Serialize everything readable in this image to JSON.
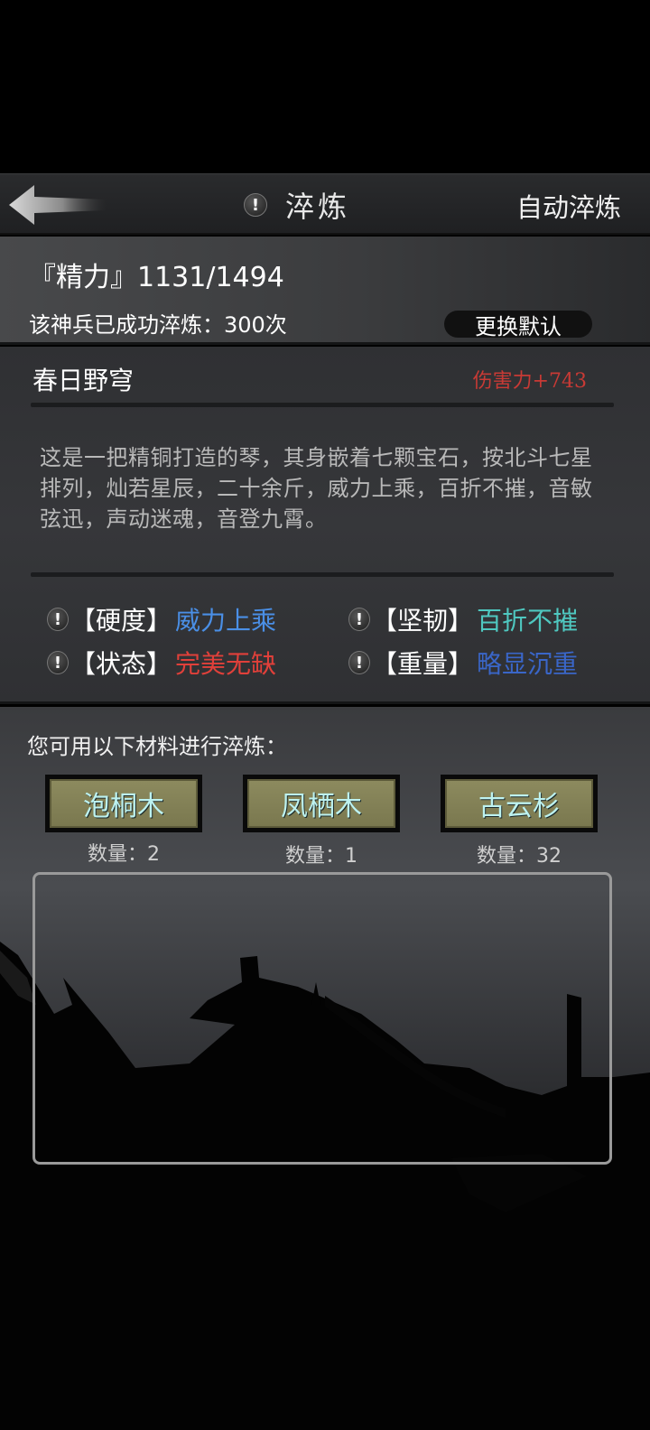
{
  "header": {
    "title": "淬炼",
    "warn_glyph": "!",
    "auto_label": "自动淬炼"
  },
  "stats": {
    "energy": "『精力』1131/1494",
    "refined": "该神兵已成功淬炼：300次",
    "change_default": "更换默认"
  },
  "weapon": {
    "name": "春日野穹",
    "damage": "伤害力+743",
    "description": "这是一把精铜打造的琴，其身嵌着七颗宝石，按北斗七星排列，灿若星辰，二十余斤，威力上乘，百折不摧，音敏弦迅，声动迷魂，音登九霄。",
    "attributes": [
      {
        "label": "【硬度】",
        "value": "威力上乘",
        "color": "#4a8fe6"
      },
      {
        "label": "【坚韧】",
        "value": "百折不摧",
        "color": "#4fc8c0"
      },
      {
        "label": "【状态】",
        "value": "完美无缺",
        "color": "#e0403a"
      },
      {
        "label": "【重量】",
        "value": "略显沉重",
        "color": "#3a66c8"
      }
    ]
  },
  "materials": {
    "prompt": "您可用以下材料进行淬炼：",
    "items": [
      {
        "name": "泡桐木",
        "qty": "数量：2"
      },
      {
        "name": "凤栖木",
        "qty": "数量：1"
      },
      {
        "name": "古云杉",
        "qty": "数量：32"
      }
    ]
  },
  "colors": {
    "damage": "#c83a35",
    "material_button": "#8c8a5e",
    "material_text": "#bdf2f0"
  }
}
